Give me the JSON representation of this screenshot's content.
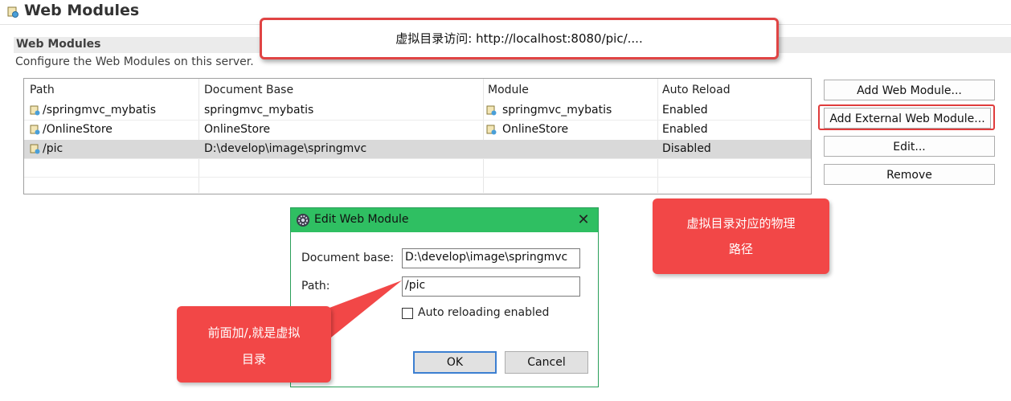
{
  "header": {
    "title": "Web Modules",
    "icon": "web-module-icon"
  },
  "section": {
    "title": "Web Modules",
    "description": "Configure the Web Modules on this server."
  },
  "table": {
    "columns": [
      "Path",
      "Document Base",
      "Module",
      "Auto Reload"
    ],
    "rows": [
      {
        "path": "/springmvc_mybatis",
        "document_base": "springmvc_mybatis",
        "module": "springmvc_mybatis",
        "auto_reload": "Enabled",
        "selected": false
      },
      {
        "path": "/OnlineStore",
        "document_base": "OnlineStore",
        "module": "OnlineStore",
        "auto_reload": "Enabled",
        "selected": false
      },
      {
        "path": "/pic",
        "document_base": "D:\\develop\\image\\springmvc",
        "module": "",
        "auto_reload": "Disabled",
        "selected": true
      }
    ]
  },
  "buttons": {
    "add_web_module": "Add Web Module...",
    "add_external_web_module": "Add External Web Module...",
    "edit": "Edit...",
    "remove": "Remove"
  },
  "callouts": {
    "top": "虚拟目录访问:  http://localhost:8080/pic/....",
    "right_line1": "虚拟目录对应的物理",
    "right_line2": "路径",
    "left_line1": "前面加/,就是虚拟",
    "left_line2": "目录"
  },
  "dialog": {
    "title": "Edit Web Module",
    "document_base_label": "Document base:",
    "document_base_value": "D:\\develop\\image\\springmvc",
    "path_label": "Path:",
    "path_value": "/pic",
    "auto_reload_label": "Auto reloading enabled",
    "auto_reload_checked": false,
    "ok": "OK",
    "cancel": "Cancel"
  },
  "colors": {
    "callout": "#f24747",
    "highlight_border": "#e03c3c",
    "dialog_title": "#2fbf62",
    "selected_row": "#d9d9d9"
  }
}
